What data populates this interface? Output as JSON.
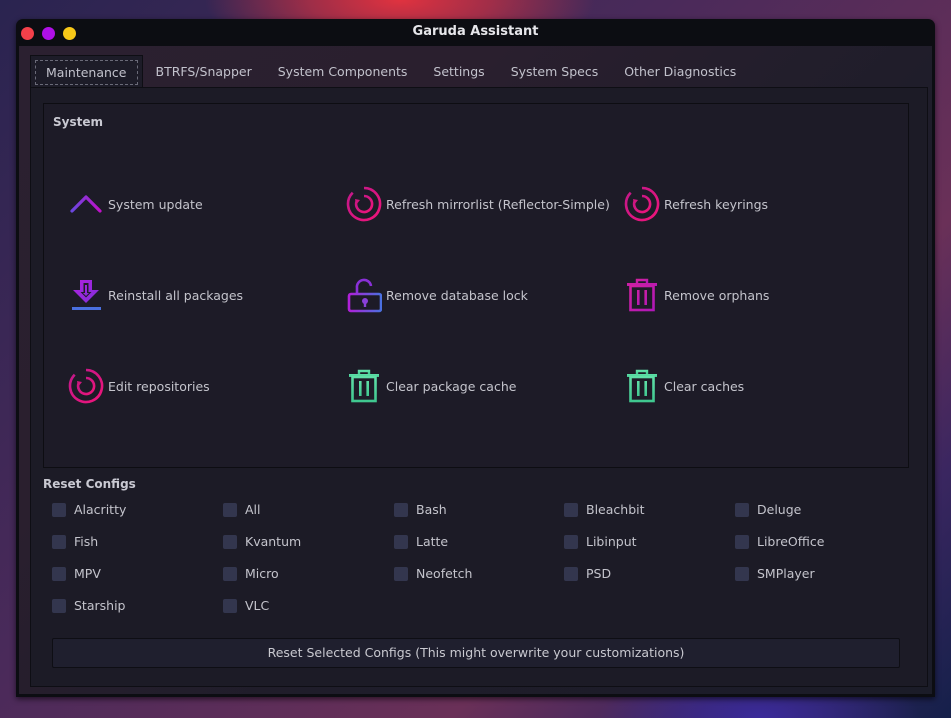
{
  "window": {
    "title": "Garuda Assistant",
    "controls": [
      "close",
      "minimize",
      "maximize"
    ]
  },
  "tabs": [
    {
      "label": "Maintenance",
      "active": true
    },
    {
      "label": "BTRFS/Snapper",
      "active": false
    },
    {
      "label": "System Components",
      "active": false
    },
    {
      "label": "Settings",
      "active": false
    },
    {
      "label": "System Specs",
      "active": false
    },
    {
      "label": "Other Diagnostics",
      "active": false
    }
  ],
  "system": {
    "title": "System",
    "actions": [
      {
        "label": "System update",
        "icon": "chevron-up-icon"
      },
      {
        "label": "Refresh mirrorlist (Reflector-Simple)",
        "icon": "refresh-icon"
      },
      {
        "label": "Refresh keyrings",
        "icon": "refresh-icon"
      },
      {
        "label": "Reinstall all packages",
        "icon": "download-icon"
      },
      {
        "label": "Remove database lock",
        "icon": "unlock-icon"
      },
      {
        "label": "Remove orphans",
        "icon": "trash-icon"
      },
      {
        "label": "Edit repositories",
        "icon": "refresh-icon"
      },
      {
        "label": "Clear package cache",
        "icon": "trash-icon"
      },
      {
        "label": "Clear caches",
        "icon": "trash-icon"
      }
    ]
  },
  "reset_configs": {
    "title": "Reset Configs",
    "items": [
      {
        "label": "Alacritty",
        "checked": false
      },
      {
        "label": "All",
        "checked": false
      },
      {
        "label": "Bash",
        "checked": false
      },
      {
        "label": "Bleachbit",
        "checked": false
      },
      {
        "label": "Deluge",
        "checked": false
      },
      {
        "label": "Fish",
        "checked": false
      },
      {
        "label": "Kvantum",
        "checked": false
      },
      {
        "label": "Latte",
        "checked": false
      },
      {
        "label": "Libinput",
        "checked": false
      },
      {
        "label": "LibreOffice",
        "checked": false
      },
      {
        "label": "MPV",
        "checked": false
      },
      {
        "label": "Micro",
        "checked": false
      },
      {
        "label": "Neofetch",
        "checked": false
      },
      {
        "label": "PSD",
        "checked": false
      },
      {
        "label": "SMPlayer",
        "checked": false
      },
      {
        "label": "Starship",
        "checked": false
      },
      {
        "label": "VLC",
        "checked": false
      }
    ],
    "button_label": "Reset Selected Configs (This might overwrite your customizations)"
  },
  "colors": {
    "close": "#f4404a",
    "minimize": "#b010e8",
    "maximize": "#f8c818",
    "icon_pink": "#e8147a",
    "icon_purple": "#a020e0",
    "icon_blue": "#4a70e0",
    "icon_green": "#50d8a0"
  }
}
